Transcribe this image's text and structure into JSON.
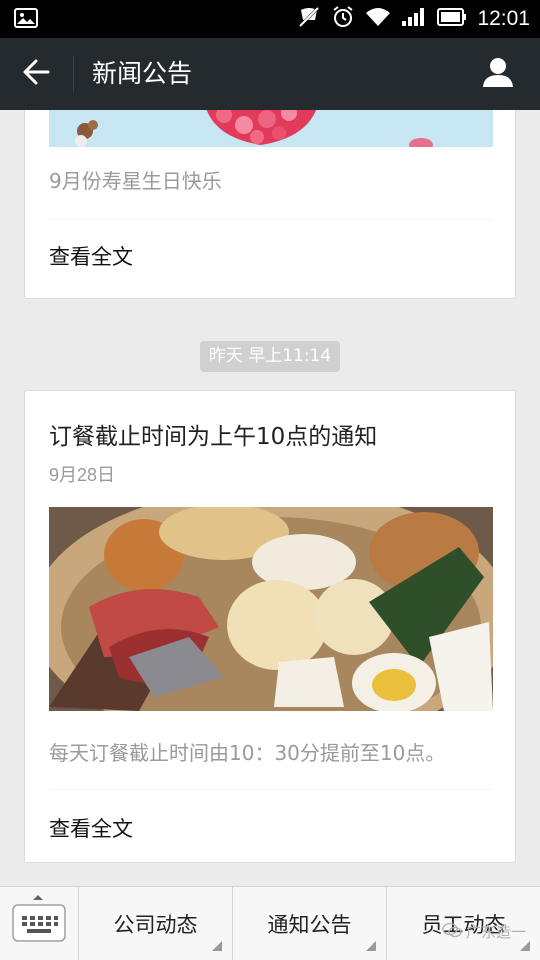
{
  "status_bar": {
    "time": "12:01",
    "icons": [
      "image-icon",
      "mute-icon",
      "alarm-icon",
      "wifi-icon",
      "signal-icon",
      "battery-icon"
    ]
  },
  "header": {
    "title": "新闻公告",
    "back_icon": "back-arrow-icon",
    "profile_icon": "user-icon"
  },
  "feed": {
    "items": [
      {
        "summary": "9月份寿星生日快乐",
        "read_more": "查看全文"
      },
      {
        "timestamp": "昨天 早上11:14",
        "title": "订餐截止时间为上午10点的通知",
        "date": "9月28日",
        "summary": "每天订餐截止时间由10：30分提前至10点。",
        "read_more": "查看全文"
      }
    ]
  },
  "bottom_menu": {
    "keyboard_icon": "keyboard-icon",
    "tabs": [
      {
        "label": "公司动态"
      },
      {
        "label": "通知公告"
      },
      {
        "label": "员工动态"
      }
    ],
    "watermark": "广东造一"
  },
  "colors": {
    "header_bg": "#252a2e",
    "page_bg": "#ebebeb",
    "time_badge_bg": "#d0d0d0"
  }
}
